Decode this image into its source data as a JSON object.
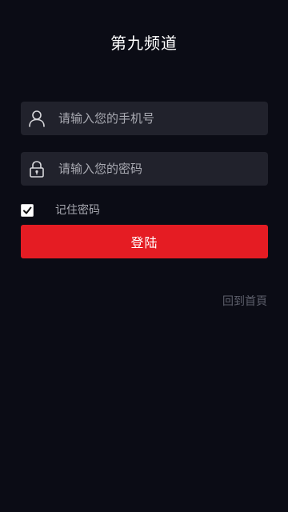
{
  "header": {
    "title": "第九频道"
  },
  "form": {
    "phone_placeholder": "请输入您的手机号",
    "password_placeholder": "请输入您的密码",
    "phone_icon": "user-icon",
    "password_icon": "lock-icon",
    "remember_label": "记住密码",
    "remember_checked": true,
    "login_label": "登陆"
  },
  "footer": {
    "home_link": "回到首頁"
  },
  "colors": {
    "background": "#0b0c15",
    "field_background": "#21222c",
    "accent": "#e51c23",
    "placeholder_text": "#a9aab2",
    "link_text": "#5d5f6b"
  }
}
